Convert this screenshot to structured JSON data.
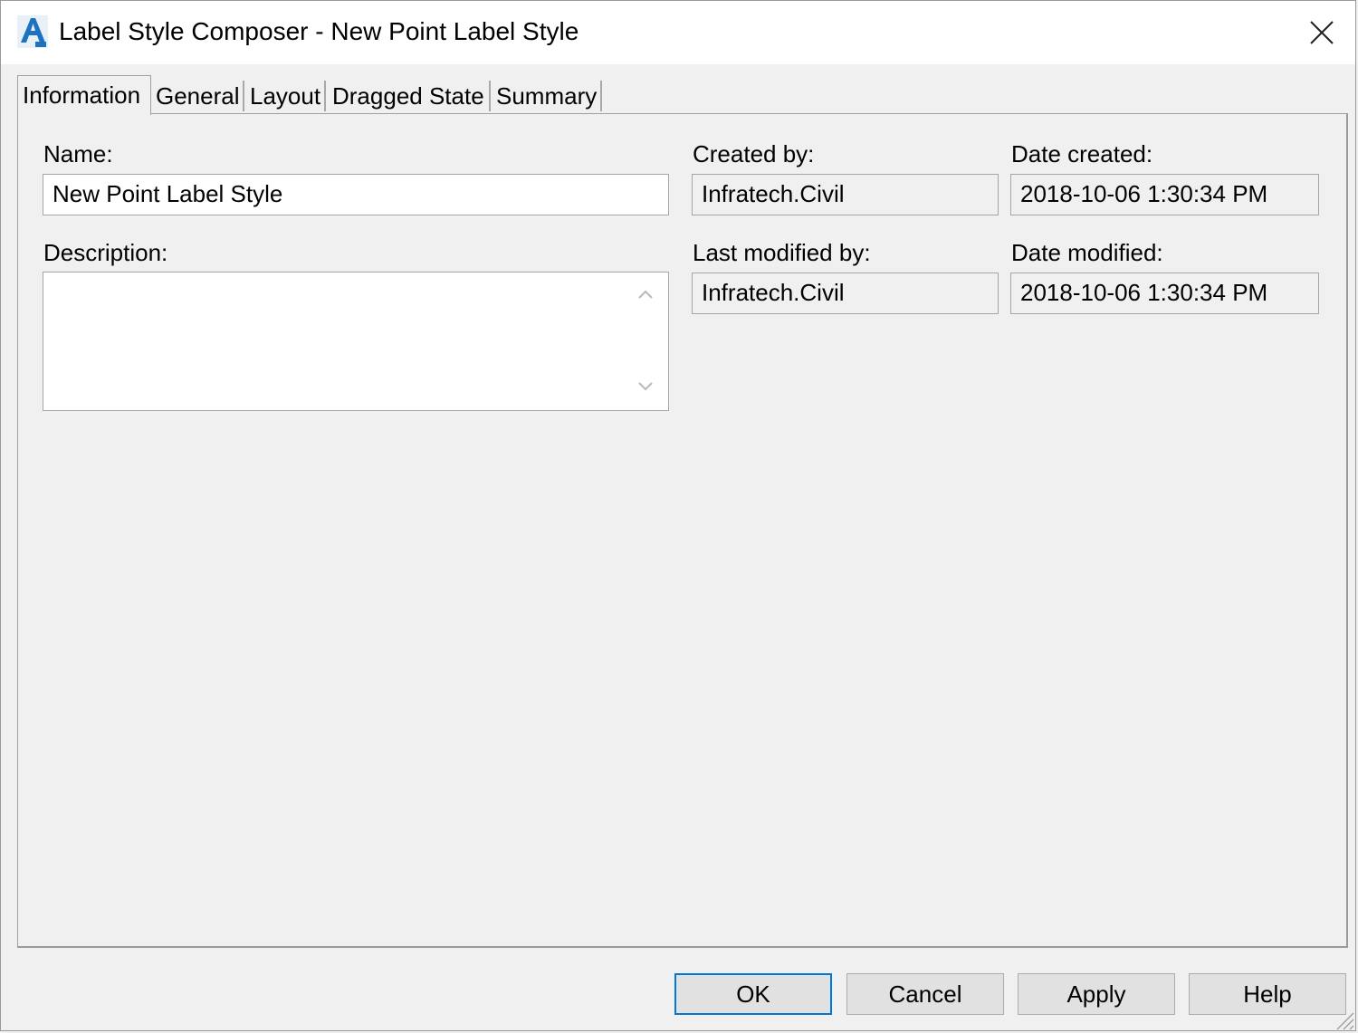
{
  "window": {
    "title": "Label Style Composer - New Point Label Style"
  },
  "tabs": [
    {
      "label": "Information",
      "active": true
    },
    {
      "label": "General",
      "active": false
    },
    {
      "label": "Layout",
      "active": false
    },
    {
      "label": "Dragged State",
      "active": false
    },
    {
      "label": "Summary",
      "active": false
    }
  ],
  "info": {
    "name_label": "Name:",
    "name_value": "New Point Label Style",
    "description_label": "Description:",
    "description_value": "",
    "created_by_label": "Created by:",
    "created_by_value": "Infratech.Civil",
    "date_created_label": "Date created:",
    "date_created_value": "2018-10-06 1:30:34 PM",
    "last_modified_by_label": "Last modified by:",
    "last_modified_by_value": "Infratech.Civil",
    "date_modified_label": "Date modified:",
    "date_modified_value": "2018-10-06 1:30:34 PM"
  },
  "buttons": {
    "ok": "OK",
    "cancel": "Cancel",
    "apply": "Apply",
    "help": "Help"
  },
  "colors": {
    "accent": "#0078d7",
    "icon_blue": "#1e73be"
  },
  "icons": {
    "app": "autocad-civil-icon",
    "close": "close-icon",
    "grip": "resize-grip-icon"
  }
}
